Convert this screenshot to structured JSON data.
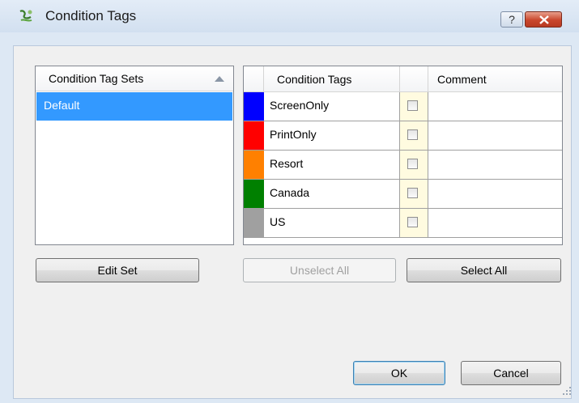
{
  "window": {
    "title": "Condition Tags",
    "help_glyph": "?",
    "icon": "condition-tags-app-icon"
  },
  "tag_sets": {
    "header": "Condition Tag Sets",
    "items": [
      "Default"
    ],
    "selected": "Default"
  },
  "tags_grid": {
    "columns": {
      "tags": "Condition Tags",
      "comment": "Comment"
    },
    "rows": [
      {
        "name": "ScreenOnly",
        "color": "#0000ff",
        "checked": false,
        "comment": ""
      },
      {
        "name": "PrintOnly",
        "color": "#ff0000",
        "checked": false,
        "comment": ""
      },
      {
        "name": "Resort",
        "color": "#ff8000",
        "checked": false,
        "comment": ""
      },
      {
        "name": "Canada",
        "color": "#008000",
        "checked": false,
        "comment": ""
      },
      {
        "name": "US",
        "color": "#a0a0a0",
        "checked": false,
        "comment": ""
      }
    ]
  },
  "buttons": {
    "edit_set": "Edit Set",
    "unselect_all": "Unselect All",
    "select_all": "Select All",
    "ok": "OK",
    "cancel": "Cancel"
  }
}
